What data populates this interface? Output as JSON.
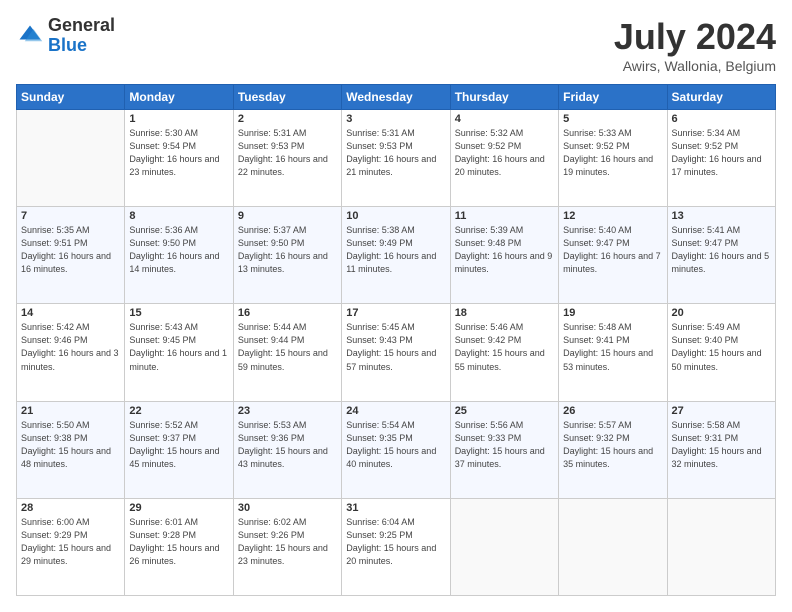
{
  "logo": {
    "general": "General",
    "blue": "Blue"
  },
  "header": {
    "month": "July 2024",
    "location": "Awirs, Wallonia, Belgium"
  },
  "weekdays": [
    "Sunday",
    "Monday",
    "Tuesday",
    "Wednesday",
    "Thursday",
    "Friday",
    "Saturday"
  ],
  "weeks": [
    [
      {
        "day": "",
        "sunrise": "",
        "sunset": "",
        "daylight": ""
      },
      {
        "day": "1",
        "sunrise": "Sunrise: 5:30 AM",
        "sunset": "Sunset: 9:54 PM",
        "daylight": "Daylight: 16 hours and 23 minutes."
      },
      {
        "day": "2",
        "sunrise": "Sunrise: 5:31 AM",
        "sunset": "Sunset: 9:53 PM",
        "daylight": "Daylight: 16 hours and 22 minutes."
      },
      {
        "day": "3",
        "sunrise": "Sunrise: 5:31 AM",
        "sunset": "Sunset: 9:53 PM",
        "daylight": "Daylight: 16 hours and 21 minutes."
      },
      {
        "day": "4",
        "sunrise": "Sunrise: 5:32 AM",
        "sunset": "Sunset: 9:52 PM",
        "daylight": "Daylight: 16 hours and 20 minutes."
      },
      {
        "day": "5",
        "sunrise": "Sunrise: 5:33 AM",
        "sunset": "Sunset: 9:52 PM",
        "daylight": "Daylight: 16 hours and 19 minutes."
      },
      {
        "day": "6",
        "sunrise": "Sunrise: 5:34 AM",
        "sunset": "Sunset: 9:52 PM",
        "daylight": "Daylight: 16 hours and 17 minutes."
      }
    ],
    [
      {
        "day": "7",
        "sunrise": "Sunrise: 5:35 AM",
        "sunset": "Sunset: 9:51 PM",
        "daylight": "Daylight: 16 hours and 16 minutes."
      },
      {
        "day": "8",
        "sunrise": "Sunrise: 5:36 AM",
        "sunset": "Sunset: 9:50 PM",
        "daylight": "Daylight: 16 hours and 14 minutes."
      },
      {
        "day": "9",
        "sunrise": "Sunrise: 5:37 AM",
        "sunset": "Sunset: 9:50 PM",
        "daylight": "Daylight: 16 hours and 13 minutes."
      },
      {
        "day": "10",
        "sunrise": "Sunrise: 5:38 AM",
        "sunset": "Sunset: 9:49 PM",
        "daylight": "Daylight: 16 hours and 11 minutes."
      },
      {
        "day": "11",
        "sunrise": "Sunrise: 5:39 AM",
        "sunset": "Sunset: 9:48 PM",
        "daylight": "Daylight: 16 hours and 9 minutes."
      },
      {
        "day": "12",
        "sunrise": "Sunrise: 5:40 AM",
        "sunset": "Sunset: 9:47 PM",
        "daylight": "Daylight: 16 hours and 7 minutes."
      },
      {
        "day": "13",
        "sunrise": "Sunrise: 5:41 AM",
        "sunset": "Sunset: 9:47 PM",
        "daylight": "Daylight: 16 hours and 5 minutes."
      }
    ],
    [
      {
        "day": "14",
        "sunrise": "Sunrise: 5:42 AM",
        "sunset": "Sunset: 9:46 PM",
        "daylight": "Daylight: 16 hours and 3 minutes."
      },
      {
        "day": "15",
        "sunrise": "Sunrise: 5:43 AM",
        "sunset": "Sunset: 9:45 PM",
        "daylight": "Daylight: 16 hours and 1 minute."
      },
      {
        "day": "16",
        "sunrise": "Sunrise: 5:44 AM",
        "sunset": "Sunset: 9:44 PM",
        "daylight": "Daylight: 15 hours and 59 minutes."
      },
      {
        "day": "17",
        "sunrise": "Sunrise: 5:45 AM",
        "sunset": "Sunset: 9:43 PM",
        "daylight": "Daylight: 15 hours and 57 minutes."
      },
      {
        "day": "18",
        "sunrise": "Sunrise: 5:46 AM",
        "sunset": "Sunset: 9:42 PM",
        "daylight": "Daylight: 15 hours and 55 minutes."
      },
      {
        "day": "19",
        "sunrise": "Sunrise: 5:48 AM",
        "sunset": "Sunset: 9:41 PM",
        "daylight": "Daylight: 15 hours and 53 minutes."
      },
      {
        "day": "20",
        "sunrise": "Sunrise: 5:49 AM",
        "sunset": "Sunset: 9:40 PM",
        "daylight": "Daylight: 15 hours and 50 minutes."
      }
    ],
    [
      {
        "day": "21",
        "sunrise": "Sunrise: 5:50 AM",
        "sunset": "Sunset: 9:38 PM",
        "daylight": "Daylight: 15 hours and 48 minutes."
      },
      {
        "day": "22",
        "sunrise": "Sunrise: 5:52 AM",
        "sunset": "Sunset: 9:37 PM",
        "daylight": "Daylight: 15 hours and 45 minutes."
      },
      {
        "day": "23",
        "sunrise": "Sunrise: 5:53 AM",
        "sunset": "Sunset: 9:36 PM",
        "daylight": "Daylight: 15 hours and 43 minutes."
      },
      {
        "day": "24",
        "sunrise": "Sunrise: 5:54 AM",
        "sunset": "Sunset: 9:35 PM",
        "daylight": "Daylight: 15 hours and 40 minutes."
      },
      {
        "day": "25",
        "sunrise": "Sunrise: 5:56 AM",
        "sunset": "Sunset: 9:33 PM",
        "daylight": "Daylight: 15 hours and 37 minutes."
      },
      {
        "day": "26",
        "sunrise": "Sunrise: 5:57 AM",
        "sunset": "Sunset: 9:32 PM",
        "daylight": "Daylight: 15 hours and 35 minutes."
      },
      {
        "day": "27",
        "sunrise": "Sunrise: 5:58 AM",
        "sunset": "Sunset: 9:31 PM",
        "daylight": "Daylight: 15 hours and 32 minutes."
      }
    ],
    [
      {
        "day": "28",
        "sunrise": "Sunrise: 6:00 AM",
        "sunset": "Sunset: 9:29 PM",
        "daylight": "Daylight: 15 hours and 29 minutes."
      },
      {
        "day": "29",
        "sunrise": "Sunrise: 6:01 AM",
        "sunset": "Sunset: 9:28 PM",
        "daylight": "Daylight: 15 hours and 26 minutes."
      },
      {
        "day": "30",
        "sunrise": "Sunrise: 6:02 AM",
        "sunset": "Sunset: 9:26 PM",
        "daylight": "Daylight: 15 hours and 23 minutes."
      },
      {
        "day": "31",
        "sunrise": "Sunrise: 6:04 AM",
        "sunset": "Sunset: 9:25 PM",
        "daylight": "Daylight: 15 hours and 20 minutes."
      },
      {
        "day": "",
        "sunrise": "",
        "sunset": "",
        "daylight": ""
      },
      {
        "day": "",
        "sunrise": "",
        "sunset": "",
        "daylight": ""
      },
      {
        "day": "",
        "sunrise": "",
        "sunset": "",
        "daylight": ""
      }
    ]
  ]
}
